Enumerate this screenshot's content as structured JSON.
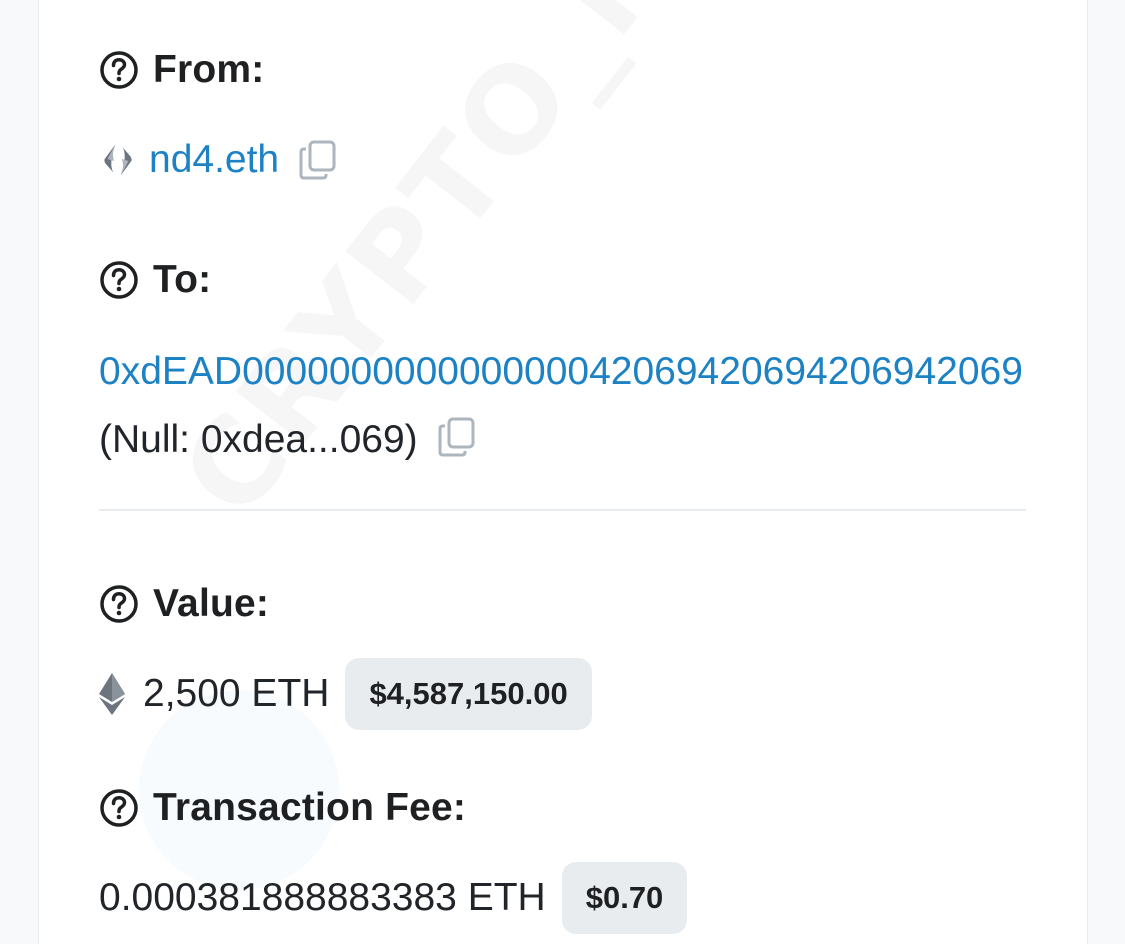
{
  "from": {
    "label": "From:",
    "name": "nd4.eth"
  },
  "to": {
    "label": "To:",
    "address": "0xdEAD000000000000000042069420694206942069",
    "note": "(Null: 0xdea...069)"
  },
  "value": {
    "label": "Value:",
    "amount": "2,500 ETH",
    "usd": "$4,587,150.00"
  },
  "fee": {
    "label": "Transaction Fee:",
    "amount": "0.000381888883383 ETH",
    "usd": "$0.70"
  },
  "watermark": "CRYPTO_HD",
  "colors": {
    "link": "#1c82c4",
    "label": "#1e2022",
    "badge_bg": "#e9ecef",
    "copy_icon": "#adb5bd"
  },
  "icons": {
    "help": "question-circle-icon",
    "ens": "ens-logo-icon",
    "copy": "copy-icon",
    "eth": "ethereum-icon"
  }
}
